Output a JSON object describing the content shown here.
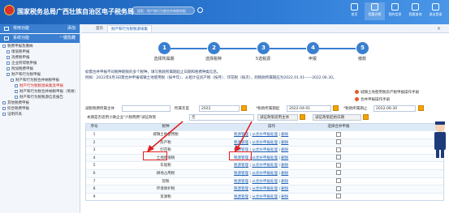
{
  "header": {
    "site_title": "国家税务总局广西壮族自治区电子税务局",
    "search_placeholder": "搜索：财产和行为税合并纳税申报",
    "nav": [
      {
        "label": "首页",
        "icon": "home-icon"
      },
      {
        "label": "我要办税",
        "icon": "tax-icon"
      },
      {
        "label": "我的信息",
        "icon": "user-icon"
      },
      {
        "label": "我要查询",
        "icon": "query-icon"
      },
      {
        "label": "退出登录",
        "icon": "logout-icon"
      }
    ]
  },
  "sidebar": {
    "common_title": "常用功能",
    "common_action": "添加",
    "system_title": "系统功能",
    "system_action": "一键隐藏",
    "tree": [
      "税费申报及缴纳",
      "增值税申报",
      "消费税申报",
      "企业所得税申报",
      "附加税费申报",
      "财产和行为税申报",
      "财产和行为税合并纳税申报",
      "财产行为税税源采集及申报",
      "财产和行为税合并纳税申报（简易）",
      "财产和行为税税源信息报告",
      "其他税费申报",
      "综合税费申报",
      "证明开具"
    ]
  },
  "tabs": {
    "home": "首页",
    "active": "财产和行为税税源采集"
  },
  "steps": [
    {
      "num": "1",
      "label": "选择所属期"
    },
    {
      "num": "2",
      "label": "选择税种"
    },
    {
      "num": "3",
      "label": "5选税源"
    },
    {
      "num": "4",
      "label": "申报"
    },
    {
      "num": "5",
      "label": "缴款"
    }
  ],
  "notice": {
    "line1": "如需合并申报不同税种期限的多个税种，填写税款所属期起止日期和税费种类信息。",
    "line2": "例如：2022年6月3日需合并申报城镇土地使用税（按半年）、从租计征房产税（按月）、印花税（按次），则税款所属期应为2022.01.01——2022.06.30。"
  },
  "right_buttons": {
    "manual": "城镇土地使用税房产税申报操作手册",
    "merge_manual": "合并申报操作手册"
  },
  "form": {
    "source_label": "减税税费所属主体",
    "year_label": "所属年度",
    "year_value": "2022",
    "start_label": "*税款所属期起",
    "start_value": "2022-04-01",
    "end_label": "*税款所属期止",
    "end_value": "2022-06-30",
    "six_tax_label": "本期是否适用小微企业\"六税两费\"减征政策",
    "six_tax_value": "否",
    "reduce_ident": "减征政策适用主体",
    "reduce_start": "减征政策起始日期"
  },
  "grid": {
    "headers": [
      "序号",
      "税种",
      "操作",
      "选择合并申报"
    ],
    "rows": [
      {
        "no": "1",
        "tax": "城镇土地使用税",
        "ops": [
          "税源管理",
          "从优补申报处理",
          "删除"
        ]
      },
      {
        "no": "2",
        "tax": "房产税",
        "ops": [
          "税源管理",
          "从优补申报处理",
          "删除"
        ]
      },
      {
        "no": "3",
        "tax": "印花税",
        "ops": [
          "税源管理",
          "从优补申报处理",
          "删除"
        ]
      },
      {
        "no": "4",
        "tax": "土地增值税",
        "ops": [
          "税源管理",
          "从优补申报处理",
          "删除"
        ]
      },
      {
        "no": "5",
        "tax": "车船税",
        "ops": [
          "税源管理",
          "从优补申报处理",
          "删除"
        ]
      },
      {
        "no": "6",
        "tax": "耕地占用税",
        "ops": [
          "税源管理",
          "从优补申报处理",
          "删除"
        ]
      },
      {
        "no": "7",
        "tax": "契税",
        "ops": [
          "税源管理",
          "从优补申报处理",
          "删除"
        ]
      },
      {
        "no": "8",
        "tax": "环境保护税",
        "ops": [
          "税源管理",
          "从优补申报处理",
          "删除"
        ]
      },
      {
        "no": "9",
        "tax": "资源税",
        "ops": [
          "税源管理",
          "从优补申报处理",
          "删除"
        ]
      }
    ]
  },
  "colors": {
    "brand": "#1a5fb4",
    "accent": "#f4a300",
    "highlight": "#e02020"
  }
}
